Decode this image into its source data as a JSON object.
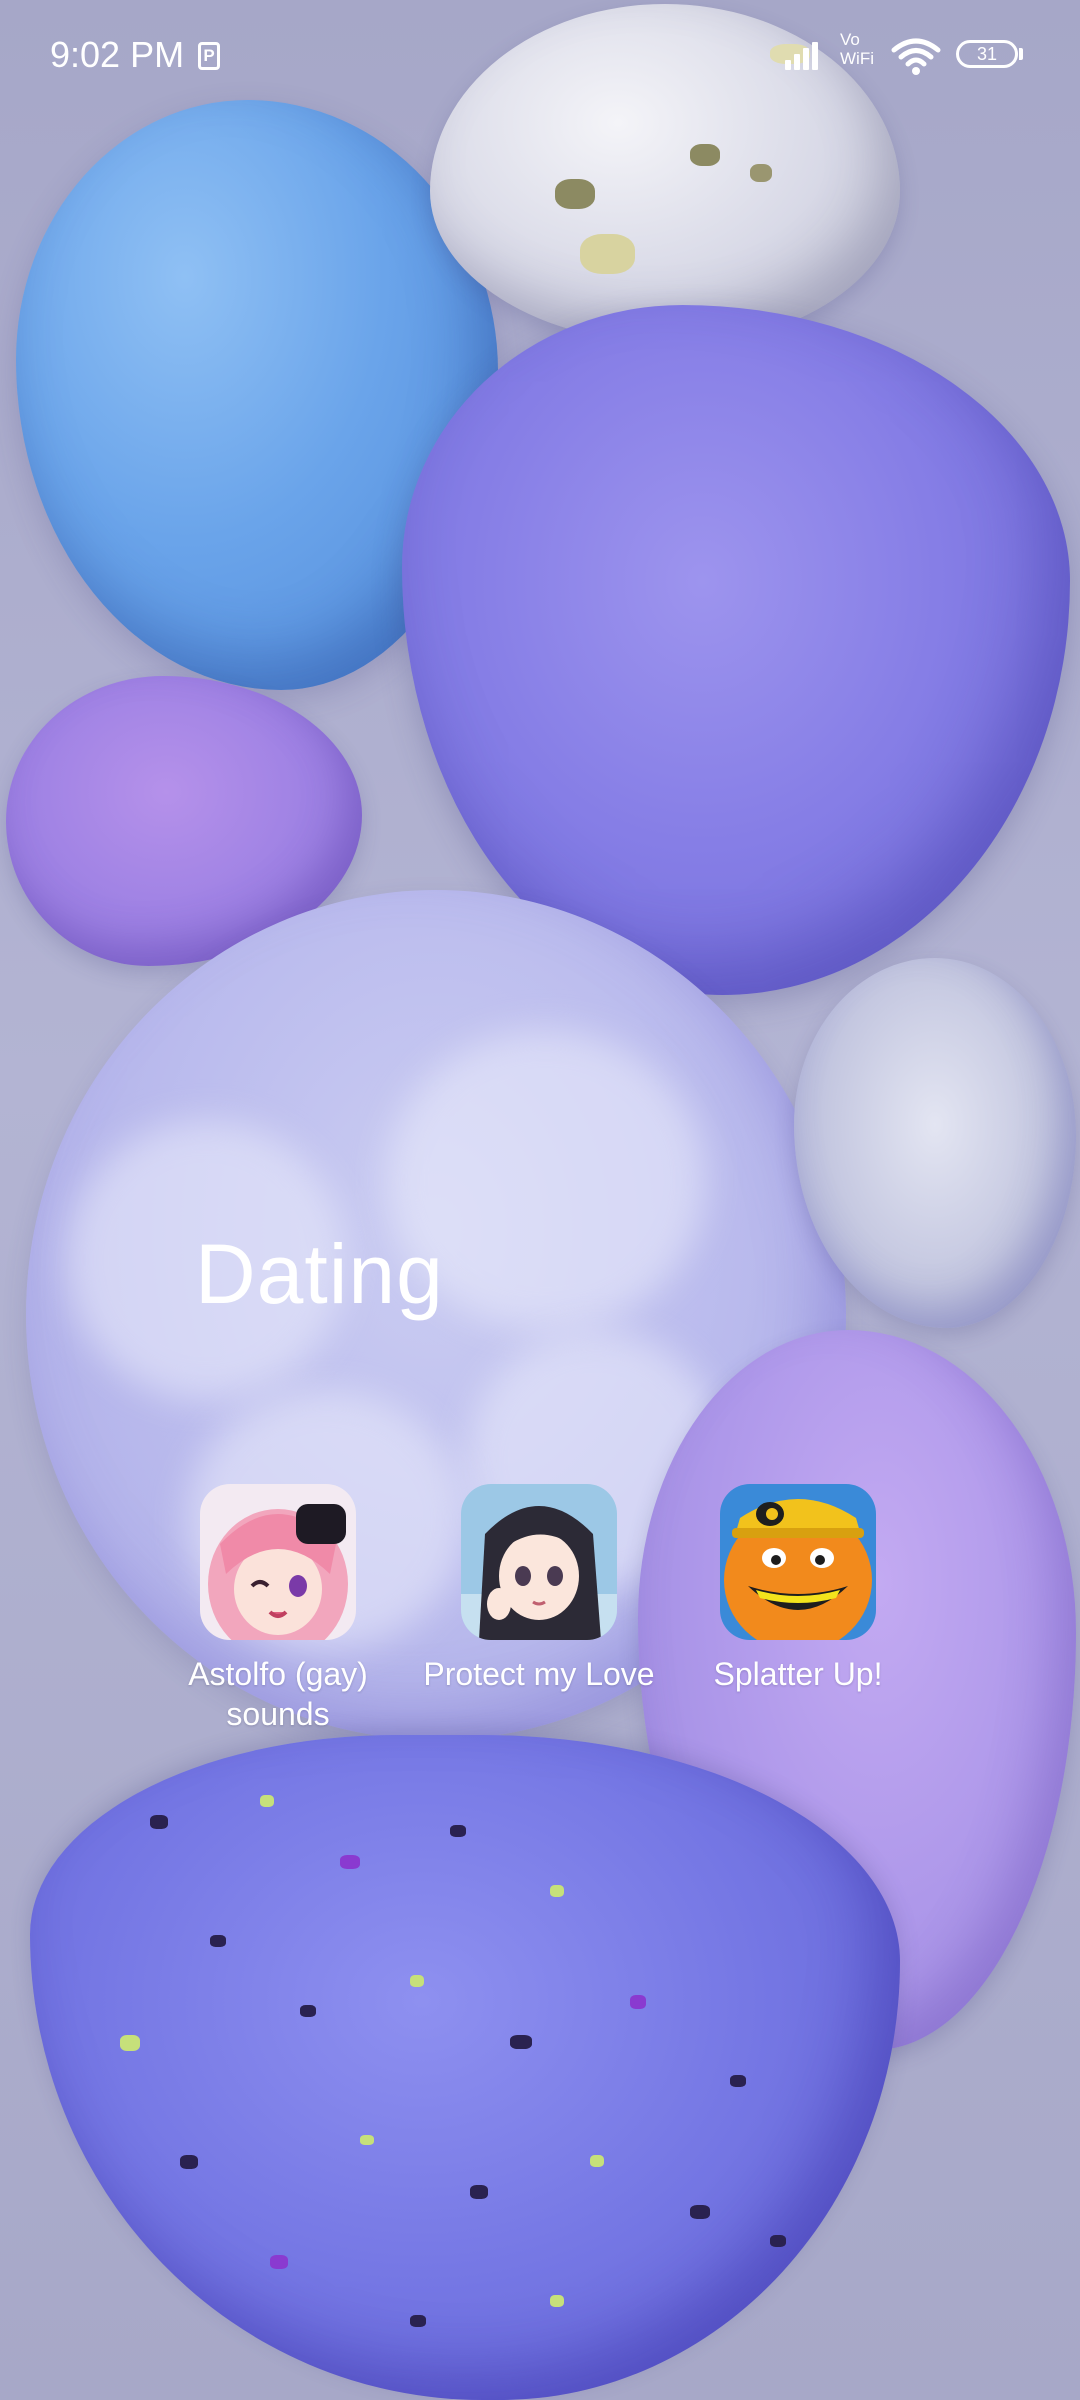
{
  "status_bar": {
    "time": "9:02 PM",
    "sim_indicator": "P",
    "vowifi_line1": "Vo",
    "vowifi_line2": "WiFi",
    "battery_level": "31",
    "icons": [
      "sim-card-icon",
      "signal-bars-icon",
      "vowifi-icon",
      "wifi-icon",
      "battery-icon"
    ]
  },
  "folder": {
    "title": "Dating",
    "apps": [
      {
        "label": "Astolfo (gay) sounds",
        "icon": "anime-pink-hair-character-icon"
      },
      {
        "label": "Protect my Love",
        "icon": "anime-dark-hair-girl-icon"
      },
      {
        "label": "Splatter Up!",
        "icon": "annoying-orange-icon"
      }
    ]
  },
  "colors": {
    "background": "#aaaacb",
    "text": "#ffffff"
  }
}
